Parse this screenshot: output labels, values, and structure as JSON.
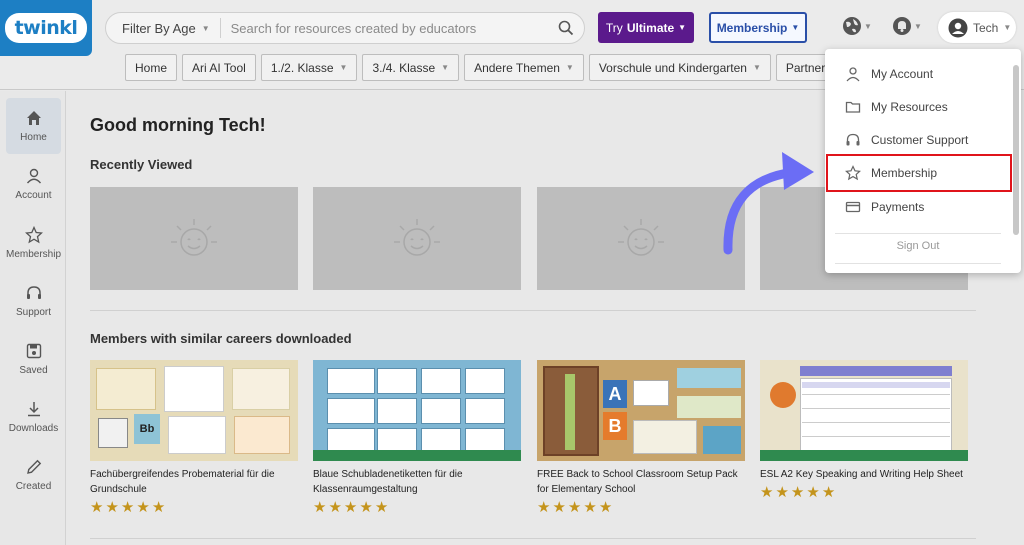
{
  "header": {
    "logo_text": "twinkl",
    "age_filter": "Filter By Age",
    "search_placeholder": "Search for resources created by educators",
    "try_ultimate_prefix": "Try",
    "try_ultimate_strong": "Ultimate",
    "membership_label": "Membership",
    "user_name": "Tech"
  },
  "nav": [
    "Home",
    "Ari AI Tool",
    "1./2. Klasse",
    "3./4. Klasse",
    "Andere Themen",
    "Vorschule und Kindergarten",
    "Partnerschaften"
  ],
  "sidebar": [
    {
      "label": "Home",
      "icon": "home-icon"
    },
    {
      "label": "Account",
      "icon": "person-icon"
    },
    {
      "label": "Membership",
      "icon": "star-icon"
    },
    {
      "label": "Support",
      "icon": "headset-icon"
    },
    {
      "label": "Saved",
      "icon": "save-icon"
    },
    {
      "label": "Downloads",
      "icon": "download-icon"
    },
    {
      "label": "Created",
      "icon": "pencil-icon"
    }
  ],
  "main": {
    "greeting": "Good morning Tech!",
    "recently_viewed": "Recently Viewed",
    "similar_title": "Members with similar careers downloaded",
    "cards": [
      {
        "title": "Fachübergreifendes Probematerial für die Grundschule",
        "rating": 5
      },
      {
        "title": "Blaue Schubladenetiketten für die Klassenraumgestaltung",
        "rating": 5
      },
      {
        "title": "FREE Back to School Classroom Setup Pack for Elementary School",
        "rating": 5
      },
      {
        "title": "ESL A2 Key Speaking and Writing Help Sheet",
        "rating": 5
      }
    ]
  },
  "dropdown": {
    "items": [
      {
        "label": "My Account",
        "icon": "person-icon"
      },
      {
        "label": "My Resources",
        "icon": "folder-icon"
      },
      {
        "label": "Customer Support",
        "icon": "headset-icon"
      },
      {
        "label": "Membership",
        "icon": "star-icon"
      },
      {
        "label": "Payments",
        "icon": "card-icon"
      }
    ],
    "sign_out": "Sign Out"
  },
  "colors": {
    "brand_blue": "#1d7fc4",
    "ultimate_purple": "#5b1a8c",
    "membership_blue": "#2a4fa8",
    "highlight_red": "#e0141b",
    "arrow_blue": "#6b6df5",
    "star_gold": "#c4941c"
  }
}
